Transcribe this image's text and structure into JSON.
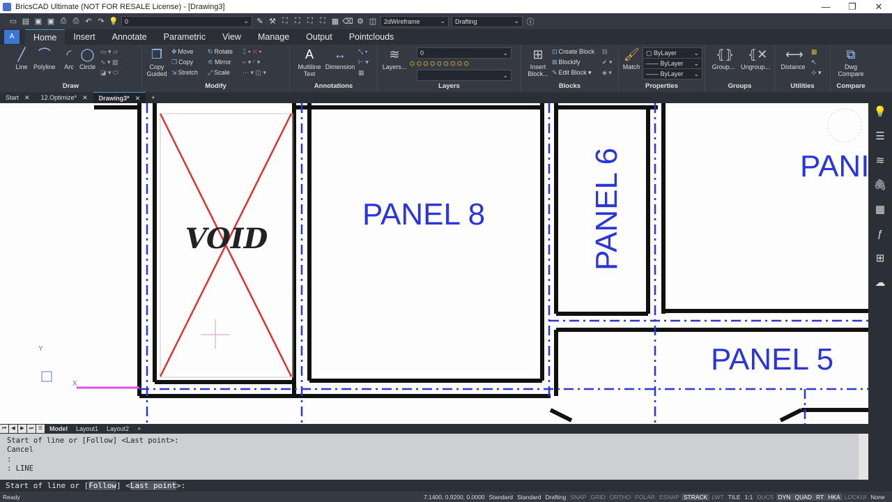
{
  "titlebar": {
    "title": "BricsCAD Ultimate (NOT FOR RESALE License) - [Drawing3]",
    "minimize": "—",
    "restore": "❐",
    "close": "✕"
  },
  "qat": {
    "layer_combo": "0",
    "visual_style": "2dWireframe",
    "workspace": "Drafting"
  },
  "ribbon_tabs": [
    "Home",
    "Insert",
    "Annotate",
    "Parametric",
    "View",
    "Manage",
    "Output",
    "Pointclouds"
  ],
  "draw": {
    "title": "Draw",
    "line": "Line",
    "polyline": "Polyline",
    "arc": "Arc",
    "circle": "Circle"
  },
  "modify": {
    "title": "Modify",
    "copy_guided_1": "Copy",
    "copy_guided_2": "Guided",
    "move": "Move",
    "copy": "Copy",
    "stretch": "Stretch",
    "rotate": "Rotate",
    "mirror": "Mirror",
    "scale": "Scale"
  },
  "annotations": {
    "title": "Annotations",
    "mtext_1": "Multiline",
    "mtext_2": "Text",
    "dimension": "Dimension"
  },
  "layers": {
    "title": "Layers",
    "layers_btn": "Layers...",
    "current": "0"
  },
  "blocks": {
    "title": "Blocks",
    "insert_1": "Insert",
    "insert_2": "Block...",
    "create": "Create Block",
    "blockify": "Blockify",
    "edit": "Edit Block"
  },
  "properties": {
    "title": "Properties",
    "match": "Match",
    "color": "ByLayer",
    "linetype": "ByLayer",
    "lineweight": "ByLayer"
  },
  "groups": {
    "title": "Groups",
    "group": "Group...",
    "ungroup": "Ungroup..."
  },
  "utilities": {
    "title": "Utilities",
    "distance": "Distance"
  },
  "compare": {
    "title": "Compare",
    "dwg_1": "Dwg",
    "dwg_2": "Compare"
  },
  "doc_tabs": [
    {
      "label": "Start",
      "close": "✕"
    },
    {
      "label": "12.Optimize*",
      "close": "✕"
    },
    {
      "label": "Drawing3*",
      "close": "✕"
    }
  ],
  "doc_add": "+",
  "drawing": {
    "void": "VOID",
    "panel8": "PANEL 8",
    "panel6": "PANEL 6",
    "panel5": "PANEL 5",
    "panel_partial": "PANI",
    "axis_y": "Y",
    "axis_x": "X"
  },
  "layout_tabs": [
    "Model",
    "Layout1",
    "Layout2"
  ],
  "layout_add": "+",
  "command_history": [
    "Start of line or [Follow] <Last point>:",
    "Cancel",
    ":",
    ": LINE"
  ],
  "command_prompt": {
    "prefix": "Start of line or [",
    "opt1": "Follow",
    "mid": "] <",
    "opt2": "Last point",
    "suffix": ">:"
  },
  "status": {
    "ready": "Ready",
    "coords": "7.1400, 0.9200, 0.0000",
    "items": [
      {
        "label": "Standard",
        "state": "text"
      },
      {
        "label": "Standard",
        "state": "text"
      },
      {
        "label": "Drafting",
        "state": "text"
      },
      {
        "label": "SNAP",
        "state": "off"
      },
      {
        "label": "GRID",
        "state": "off"
      },
      {
        "label": "ORTHO",
        "state": "off"
      },
      {
        "label": "POLAR",
        "state": "off"
      },
      {
        "label": "ESNAP",
        "state": "off"
      },
      {
        "label": "STRACK",
        "state": "on"
      },
      {
        "label": "LWT",
        "state": "off"
      },
      {
        "label": "TILE",
        "state": "text"
      },
      {
        "label": "1:1",
        "state": "text"
      },
      {
        "label": "DUCS",
        "state": "off"
      },
      {
        "label": "DYN",
        "state": "on"
      },
      {
        "label": "QUAD",
        "state": "on"
      },
      {
        "label": "RT",
        "state": "on"
      },
      {
        "label": "HKA",
        "state": "on"
      },
      {
        "label": "LOCKUI",
        "state": "off"
      },
      {
        "label": "None",
        "state": "text"
      }
    ]
  },
  "colors": {
    "accent": "#4a90e2",
    "panel_blue": "#2a36d8",
    "void_red": "#e03030"
  }
}
